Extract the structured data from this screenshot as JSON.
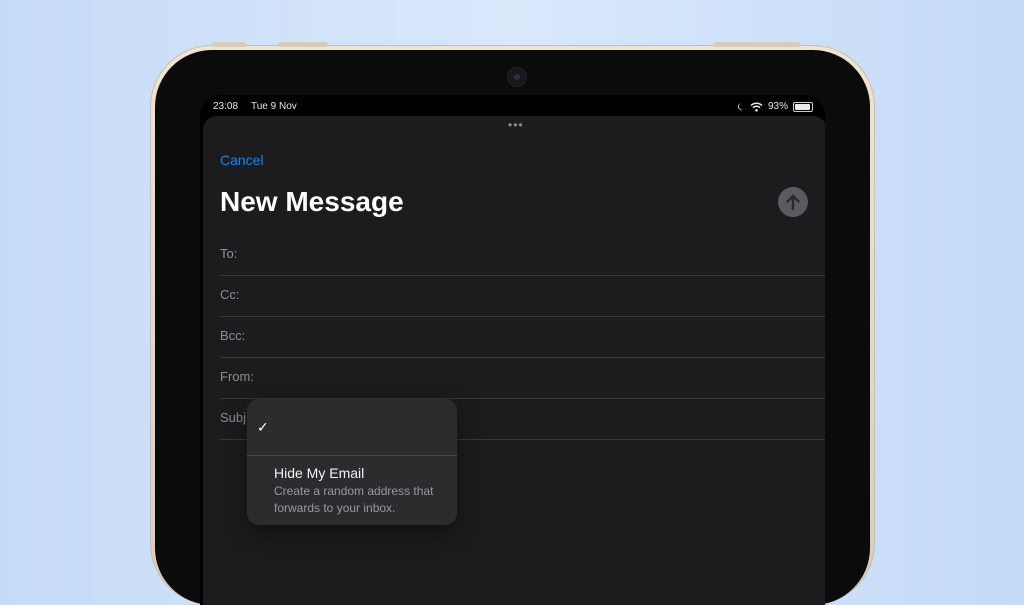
{
  "status_bar": {
    "time": "23:08",
    "date": "Tue 9 Nov",
    "battery": "93%",
    "battery_level": 0.93
  },
  "compose": {
    "cancel_label": "Cancel",
    "title": "New Message",
    "fields": {
      "to": "To:",
      "cc": "Cc:",
      "bcc": "Bcc:",
      "from": "From:",
      "subject": "Subj"
    }
  },
  "from_menu": {
    "selected_check": "✓",
    "options": [
      {
        "title": "Hide My Email",
        "description": "Create a random address that forwards to your inbox."
      }
    ]
  },
  "colors": {
    "accent": "#0a84ff",
    "sheet_background": "#1c1c1e",
    "send_button": "#5b5b5f"
  }
}
